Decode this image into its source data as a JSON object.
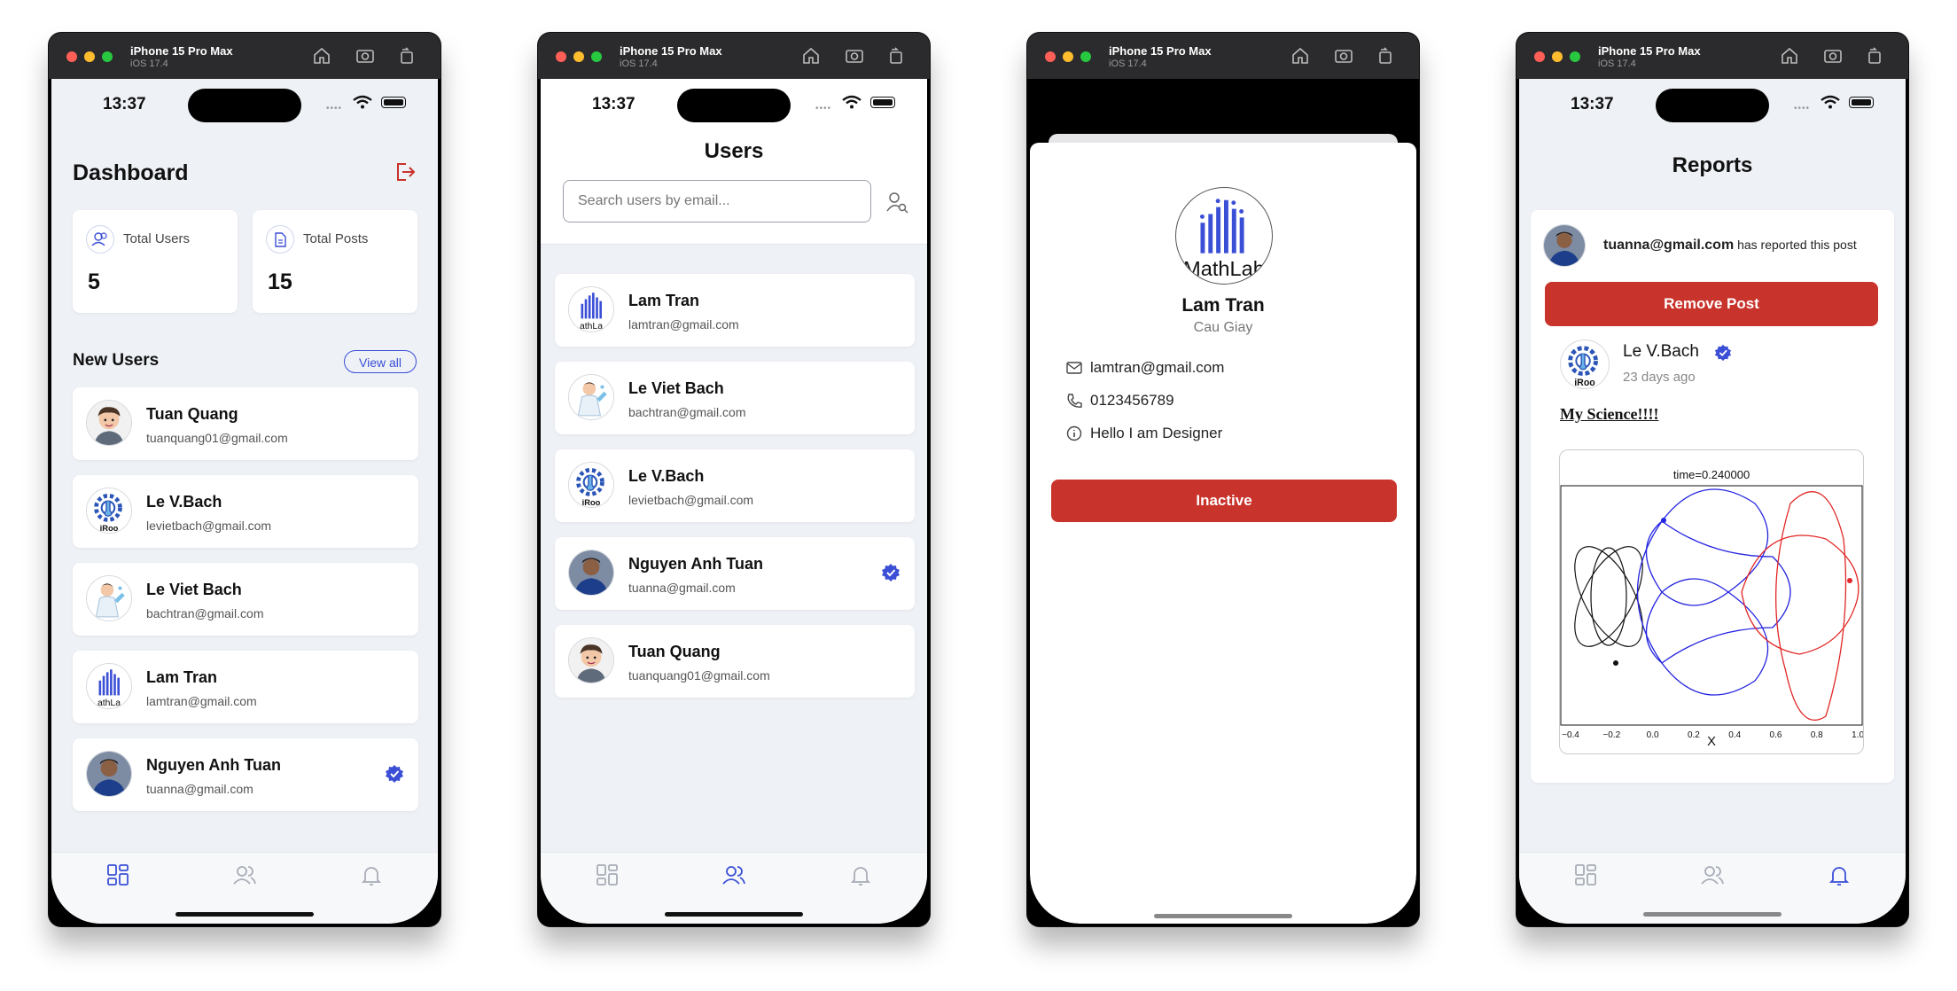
{
  "simulator": {
    "device": "iPhone 15 Pro Max",
    "os": "iOS 17.4"
  },
  "status": {
    "time": "13:37"
  },
  "dashboard": {
    "title": "Dashboard",
    "stats": [
      {
        "label": "Total Users",
        "value": "5",
        "icon": "users-icon"
      },
      {
        "label": "Total Posts",
        "value": "15",
        "icon": "document-icon"
      }
    ],
    "new_users_title": "New Users",
    "view_all_label": "View all",
    "users": [
      {
        "name": "Tuan Quang",
        "email": "tuanquang01@gmail.com",
        "avatar": "cartoon-man",
        "verified": false
      },
      {
        "name": "Le V.Bach",
        "email": "levietbach@gmail.com",
        "avatar": "gear-logo",
        "verified": false
      },
      {
        "name": "Le Viet Bach",
        "email": "bachtran@gmail.com",
        "avatar": "scientist",
        "verified": false
      },
      {
        "name": "Lam Tran",
        "email": "lamtran@gmail.com",
        "avatar": "mathlab-logo",
        "verified": false
      },
      {
        "name": "Nguyen Anh Tuan",
        "email": "tuanna@gmail.com",
        "avatar": "photo-man",
        "verified": true
      }
    ]
  },
  "users_screen": {
    "title": "Users",
    "search_placeholder": "Search users by email...",
    "users": [
      {
        "name": "Lam Tran",
        "email": "lamtran@gmail.com",
        "avatar": "mathlab-logo",
        "verified": false
      },
      {
        "name": "Le Viet Bach",
        "email": "bachtran@gmail.com",
        "avatar": "scientist",
        "verified": false
      },
      {
        "name": "Le V.Bach",
        "email": "levietbach@gmail.com",
        "avatar": "gear-logo",
        "verified": false
      },
      {
        "name": "Nguyen Anh Tuan",
        "email": "tuanna@gmail.com",
        "avatar": "photo-man",
        "verified": true
      },
      {
        "name": "Tuan Quang",
        "email": "tuanquang01@gmail.com",
        "avatar": "cartoon-man",
        "verified": false
      }
    ]
  },
  "user_detail": {
    "avatar_text": "MathLab",
    "name": "Lam Tran",
    "location": "Cau Giay",
    "email": "lamtran@gmail.com",
    "phone": "0123456789",
    "bio": "Hello I am Designer",
    "status_button": "Inactive"
  },
  "reports": {
    "title": "Reports",
    "reporter_email": "tuanna@gmail.com",
    "reporter_suffix": "has reported this post",
    "remove_button": "Remove Post",
    "author_name": "Le V.Bach",
    "author_time": "23 days ago",
    "post_title": "My Science!!!!",
    "plot_title": "time=0.240000",
    "plot_xlabel": "X",
    "plot_ticks": [
      "−0.4",
      "−0.2",
      "0.0",
      "0.2",
      "0.4",
      "0.6",
      "0.8",
      "1.0"
    ]
  },
  "colors": {
    "primary": "#3b4fd6",
    "danger": "#c8332c",
    "bg": "#eef1f6"
  }
}
